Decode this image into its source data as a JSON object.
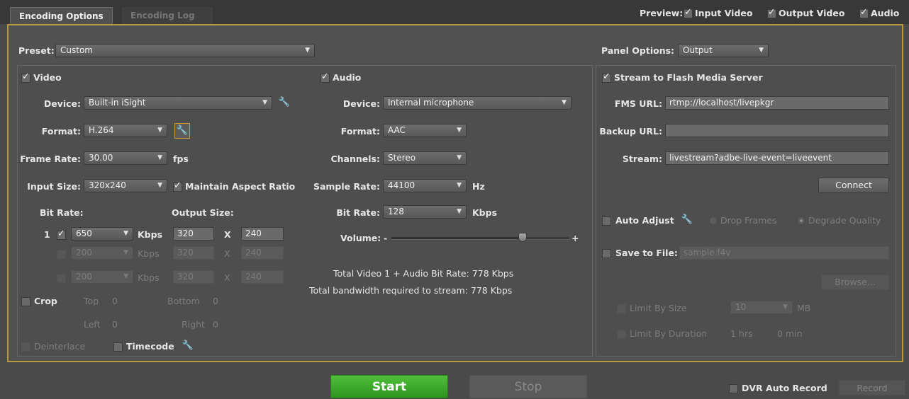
{
  "tabs": {
    "encoding_options": "Encoding Options",
    "encoding_log": "Encoding Log"
  },
  "preview": {
    "label": "Preview:",
    "input_video": "Input Video",
    "output_video": "Output Video",
    "audio": "Audio"
  },
  "preset": {
    "label": "Preset:",
    "value": "Custom"
  },
  "panel_options": {
    "label": "Panel Options:",
    "value": "Output"
  },
  "video": {
    "title": "Video",
    "device_label": "Device:",
    "device_value": "Built-in iSight",
    "format_label": "Format:",
    "format_value": "H.264",
    "frame_rate_label": "Frame Rate:",
    "frame_rate_value": "30.00",
    "fps_unit": "fps",
    "input_size_label": "Input Size:",
    "input_size_value": "320x240",
    "maintain_aspect": "Maintain Aspect Ratio",
    "bit_rate_label": "Bit Rate:",
    "output_size_label": "Output Size:",
    "x_sep": "X",
    "kbps": "Kbps",
    "rows": [
      {
        "index": "1",
        "bitrate": "650",
        "width": "320",
        "height": "240"
      },
      {
        "index": "",
        "bitrate": "200",
        "width": "320",
        "height": "240"
      },
      {
        "index": "",
        "bitrate": "200",
        "width": "320",
        "height": "240"
      }
    ],
    "crop_label": "Crop",
    "crop_top_label": "Top",
    "crop_top": "0",
    "crop_bottom_label": "Bottom",
    "crop_bottom": "0",
    "crop_left_label": "Left",
    "crop_left": "0",
    "crop_right_label": "Right",
    "crop_right": "0",
    "deinterlace": "Deinterlace",
    "timecode": "Timecode"
  },
  "audio": {
    "title": "Audio",
    "device_label": "Device:",
    "device_value": "Internal microphone",
    "format_label": "Format:",
    "format_value": "AAC",
    "channels_label": "Channels:",
    "channels_value": "Stereo",
    "sample_rate_label": "Sample Rate:",
    "sample_rate_value": "44100",
    "hz_unit": "Hz",
    "bit_rate_label": "Bit Rate:",
    "bit_rate_value": "128",
    "kbps_unit": "Kbps",
    "volume_label": "Volume:",
    "volume_minus": "-",
    "volume_plus": "+",
    "volume_level": 0.74,
    "total_bit_rate": "Total Video 1 + Audio Bit Rate: 778 Kbps",
    "total_bandwidth": "Total bandwidth required to stream: 778 Kbps"
  },
  "output": {
    "stream_to_fms": "Stream to Flash Media Server",
    "fms_url_label": "FMS URL:",
    "fms_url_value": "rtmp://localhost/livepkgr",
    "backup_url_label": "Backup URL:",
    "backup_url_value": "",
    "stream_label": "Stream:",
    "stream_value": "livestream?adbe-live-event=liveevent",
    "connect": "Connect",
    "auto_adjust": "Auto Adjust",
    "drop_frames": "Drop Frames",
    "degrade_quality": "Degrade Quality",
    "save_to_file": "Save to File:",
    "save_file_value": "sample.f4v",
    "browse": "Browse...",
    "limit_by_size": "Limit By Size",
    "limit_size_value": "10",
    "mb_unit": "MB",
    "limit_by_duration": "Limit By Duration",
    "hrs": "1 hrs",
    "min": "0 min"
  },
  "bottom": {
    "start": "Start",
    "stop": "Stop",
    "dvr_auto_record": "DVR Auto Record",
    "record": "Record"
  }
}
